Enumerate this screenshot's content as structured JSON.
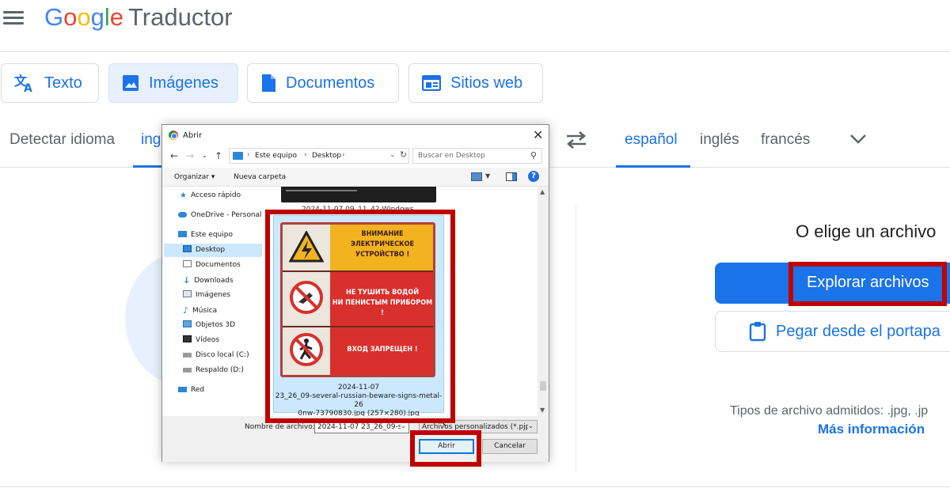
{
  "app": {
    "logo_letters": [
      "G",
      "o",
      "o",
      "g",
      "l",
      "e"
    ],
    "product": "Traductor"
  },
  "mode_tabs": [
    {
      "label": "Texto",
      "icon": "translate-icon"
    },
    {
      "label": "Imágenes",
      "icon": "image-icon",
      "active": true
    },
    {
      "label": "Documentos",
      "icon": "document-icon"
    },
    {
      "label": "Sitios web",
      "icon": "website-icon"
    }
  ],
  "source_languages": [
    "Detectar idioma",
    "ing"
  ],
  "target_languages": [
    "español",
    "inglés",
    "francés"
  ],
  "right_panel": {
    "choose_title": "O elige un archivo",
    "explore_button": "Explorar archivos",
    "paste_button": "Pegar desde el portapa",
    "file_types": "Tipos de archivo admitidos: .jpg, .jp",
    "more_info": "Más información"
  },
  "dialog": {
    "title": "Abrir",
    "breadcrumb": [
      "Este equipo",
      "Desktop"
    ],
    "search_placeholder": "Buscar en Desktop",
    "toolbar": {
      "organize": "Organizar ▾",
      "new_folder": "Nueva carpeta"
    },
    "tree": [
      {
        "label": "Acceso rápido",
        "icon": "star-icon",
        "indent": 1
      },
      {
        "label": "OneDrive - Personal",
        "icon": "cloud-icon",
        "indent": 1
      },
      {
        "label": "Este equipo",
        "icon": "computer-icon",
        "indent": 1
      },
      {
        "label": "Desktop",
        "icon": "desktop-folder-icon",
        "indent": 2,
        "selected": true
      },
      {
        "label": "Documentos",
        "icon": "documents-folder-icon",
        "indent": 2
      },
      {
        "label": "Downloads",
        "icon": "downloads-folder-icon",
        "indent": 2
      },
      {
        "label": "Imágenes",
        "icon": "pictures-folder-icon",
        "indent": 2
      },
      {
        "label": "Música",
        "icon": "music-folder-icon",
        "indent": 2
      },
      {
        "label": "Objetos 3D",
        "icon": "3d-objects-folder-icon",
        "indent": 2
      },
      {
        "label": "Vídeos",
        "icon": "videos-folder-icon",
        "indent": 2
      },
      {
        "label": "Disco local (C:)",
        "icon": "drive-icon",
        "indent": 2
      },
      {
        "label": "Respaldo (D:)",
        "icon": "drive-icon",
        "indent": 2
      },
      {
        "label": "Red",
        "icon": "network-icon",
        "indent": 1
      }
    ],
    "partial_file_caption": "2024-11-07 09_11_42-Windows...",
    "selected_file": {
      "caption_line1": "2024-11-07",
      "caption_line2": "23_26_09-several-russian-beware-signs-metal-26",
      "caption_line3": "0nw-73790830.jpg (257×280).jpg",
      "sign_text_1": [
        "ВНИМАНИЕ",
        "ЭЛЕКТРИЧЕСКОЕ",
        "УСТРОЙСТВО !"
      ],
      "sign_text_2": [
        "НЕ ТУШИТЬ ВОДОЙ",
        "НИ ПЕНИСТЫМ ПРИБОРОМ !"
      ],
      "sign_text_3": [
        "ВХОД ЗАПРЕЩЕН !"
      ]
    },
    "filename_label": "Nombre de archivo:",
    "filename_value": "2024-11-07 23_26_09-sev",
    "filetype_value": "Archivos personalizados (*.pjp;*",
    "open_button": "Abrir",
    "cancel_button": "Cancelar"
  },
  "colors": {
    "accent": "#1a73e8",
    "highlight_box": "#c00000",
    "active_tab_bg": "#e8f0fe"
  }
}
